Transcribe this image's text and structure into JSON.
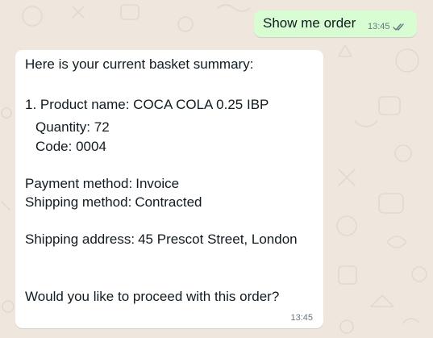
{
  "conversation": {
    "outgoing": {
      "text": "Show me order",
      "time": "13:45",
      "status_icon": "double-check-icon"
    },
    "incoming": {
      "intro": "Here is your current basket summary:",
      "product_line": "1. Product name: COCA COLA 0.25 IBP",
      "quantity_line": "Quantity: 72",
      "code_line": "Code: 0004",
      "payment_label": "Payment method:",
      "payment_value": "Invoice",
      "shipping_method_label": "Shipping method:",
      "shipping_method_value": "Contracted",
      "shipping_address_label": "Shipping address:",
      "shipping_address_value": "45 Prescot Street, London",
      "question": "Would you like to proceed with this order?",
      "time": "13:45"
    }
  },
  "colors": {
    "chat_background": "#efe7de",
    "outgoing_bubble": "#d9fdd3",
    "incoming_bubble": "#ffffff",
    "read_check": "#667781"
  }
}
